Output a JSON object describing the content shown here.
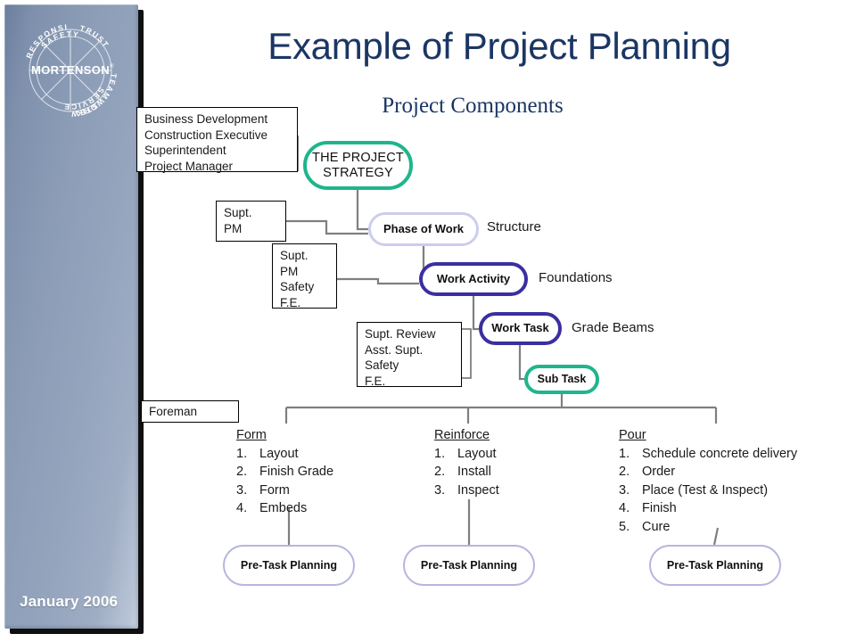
{
  "slide": {
    "title": "Example of Project Planning",
    "subtitle": "Project Components",
    "date": "January 2006",
    "logo": {
      "name": "MORTENSON",
      "values": [
        "TRUST",
        "TEAMWORK",
        "STEWARDSHIP",
        "SERVICE",
        "RESPONSIBILITY",
        "SAFETY"
      ]
    }
  },
  "colors": {
    "title": "#1b3664",
    "sidebar": "#8b9cb6",
    "teal": "#1fb58c",
    "navy": "#3b2fa0",
    "lavender": "#ccccee",
    "connector": "#7f7f7f"
  },
  "role_boxes": [
    {
      "id": "roles-exec",
      "text": "Business Development\nConstruction Executive\nSuperintendent\nProject Manager"
    },
    {
      "id": "roles-supt-pm",
      "text": "Supt.\nPM"
    },
    {
      "id": "roles-supt-pm-safety",
      "text": "Supt.\nPM\nSafety\nF.E."
    },
    {
      "id": "roles-supt-review",
      "text": "Supt. Review\nAsst. Supt.\nSafety\nF.E."
    },
    {
      "id": "roles-foreman",
      "text": "Foreman"
    }
  ],
  "nodes": [
    {
      "id": "strategy",
      "label": "THE PROJECT\nSTRATEGY",
      "color": "teal"
    },
    {
      "id": "phase",
      "label": "Phase of Work",
      "color": "lavender"
    },
    {
      "id": "activity",
      "label": "Work Activity",
      "color": "navy"
    },
    {
      "id": "task",
      "label": "Work Task",
      "color": "navy"
    },
    {
      "id": "subtask",
      "label": "Sub Task",
      "color": "teal"
    }
  ],
  "stage_labels": [
    {
      "id": "structure",
      "text": "Structure"
    },
    {
      "id": "foundations",
      "text": "Foundations"
    },
    {
      "id": "grade-beams",
      "text": "Grade Beams"
    }
  ],
  "task_columns": [
    {
      "id": "form",
      "heading": "Form",
      "items": [
        "Layout",
        "Finish Grade",
        "Form",
        "Embeds"
      ]
    },
    {
      "id": "reinforce",
      "heading": "Reinforce",
      "items": [
        "Layout",
        "Install",
        "Inspect"
      ]
    },
    {
      "id": "pour",
      "heading": "Pour",
      "items": [
        "Schedule concrete delivery",
        "Order",
        "Place (Test & Inspect)",
        "Finish",
        "Cure"
      ]
    }
  ],
  "pre_task_nodes": [
    {
      "id": "pre-task-1",
      "label": "Pre-Task Planning"
    },
    {
      "id": "pre-task-2",
      "label": "Pre-Task Planning"
    },
    {
      "id": "pre-task-3",
      "label": "Pre-Task Planning"
    }
  ]
}
